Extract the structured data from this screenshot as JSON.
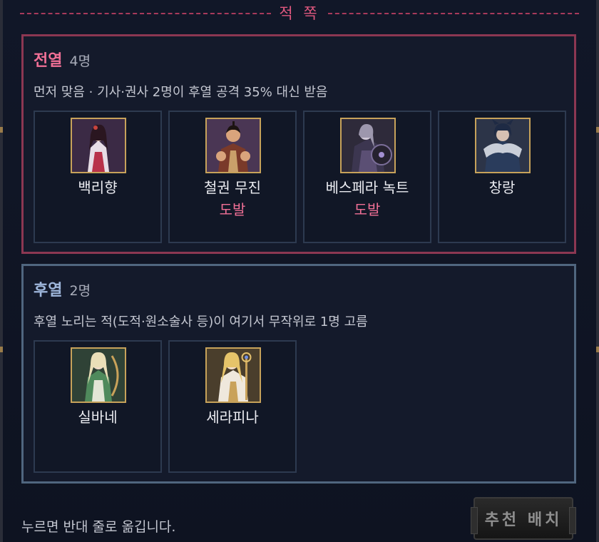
{
  "header": {
    "title": "적 쪽"
  },
  "front_row": {
    "name": "전열",
    "count": "4명",
    "description": "먼저 맞음 · 기사·권사 2명이 후열 공격 35% 대신 받음",
    "units": [
      {
        "name": "백리향",
        "tag": "",
        "portrait_icon": "swordswoman-portrait-icon"
      },
      {
        "name": "철권 무진",
        "tag": "도발",
        "portrait_icon": "fist-fighter-portrait-icon"
      },
      {
        "name": "베스페라 녹트",
        "tag": "도발",
        "portrait_icon": "dark-knight-portrait-icon"
      },
      {
        "name": "창랑",
        "tag": "",
        "portrait_icon": "wolf-warrior-portrait-icon"
      }
    ]
  },
  "back_row": {
    "name": "후열",
    "count": "2명",
    "description": "후열 노리는 적(도적·원소술사 등)이 여기서 무작위로 1명 고름",
    "units": [
      {
        "name": "실바네",
        "tag": "",
        "portrait_icon": "elf-archer-portrait-icon"
      },
      {
        "name": "세라피나",
        "tag": "",
        "portrait_icon": "priestess-portrait-icon"
      }
    ]
  },
  "footer": {
    "hint": "누르면 반대 줄로 옮깁니다.",
    "recommend_label": "추천 배치"
  },
  "colors": {
    "front_accent": "#f17096",
    "front_border": "#8c3752",
    "back_accent": "#9fb7dc",
    "back_border": "#50667f",
    "portrait_frame": "#c7a25a"
  }
}
